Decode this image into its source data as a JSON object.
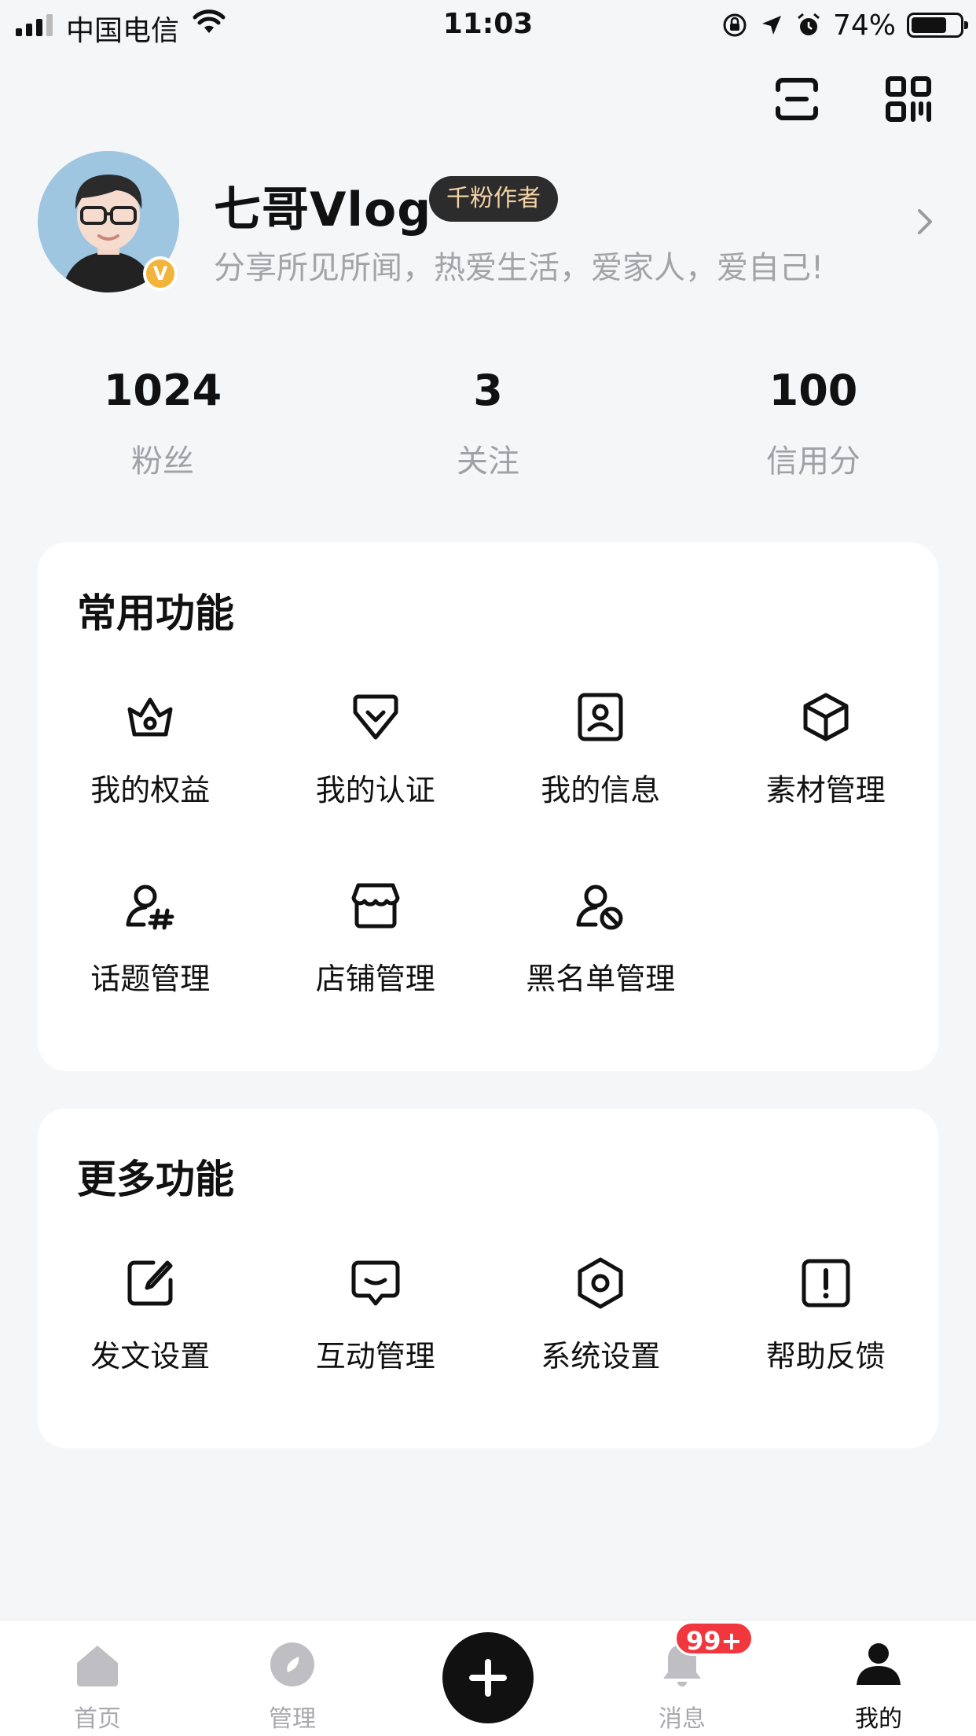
{
  "status_bar": {
    "carrier": "中国电信",
    "time": "11:03",
    "battery_percent": "74%",
    "battery_level": 0.74,
    "icons": [
      "signal-icon",
      "wifi-icon",
      "orientation-lock-icon",
      "location-icon",
      "alarm-icon",
      "battery-icon"
    ]
  },
  "top_actions": {
    "icons": [
      "scan-icon",
      "qr-code-icon"
    ]
  },
  "profile": {
    "name": "七哥Vlog",
    "tag": "千粉作者",
    "bio": "分享所见所闻，热爱生活，爱家人，爱自己!",
    "verify_mark": "V",
    "verify_color": "#f2b43a"
  },
  "stats": [
    {
      "value": "1024",
      "label": "粉丝"
    },
    {
      "value": "3",
      "label": "关注"
    },
    {
      "value": "100",
      "label": "信用分"
    }
  ],
  "common_functions": {
    "title": "常用功能",
    "items": [
      {
        "label": "我的权益",
        "icon": "crown-icon"
      },
      {
        "label": "我的认证",
        "icon": "verified-shield-icon"
      },
      {
        "label": "我的信息",
        "icon": "profile-card-icon"
      },
      {
        "label": "素材管理",
        "icon": "cube-icon"
      },
      {
        "label": "话题管理",
        "icon": "topic-icon"
      },
      {
        "label": "店铺管理",
        "icon": "store-icon"
      },
      {
        "label": "黑名单管理",
        "icon": "block-user-icon"
      }
    ]
  },
  "more_functions": {
    "title": "更多功能",
    "items": [
      {
        "label": "发文设置",
        "icon": "edit-icon"
      },
      {
        "label": "互动管理",
        "icon": "message-icon"
      },
      {
        "label": "系统设置",
        "icon": "settings-icon"
      },
      {
        "label": "帮助反馈",
        "icon": "help-feedback-icon"
      }
    ]
  },
  "tab_bar": {
    "items": [
      {
        "label": "首页",
        "icon": "home-icon",
        "active": false
      },
      {
        "label": "管理",
        "icon": "compass-icon",
        "active": false
      },
      {
        "label": "",
        "icon": "plus-icon",
        "active": false
      },
      {
        "label": "消息",
        "icon": "bell-icon",
        "active": false
      },
      {
        "label": "我的",
        "icon": "user-icon",
        "active": true
      }
    ],
    "messages_badge": "99+",
    "badge_color": "#f1373d"
  }
}
